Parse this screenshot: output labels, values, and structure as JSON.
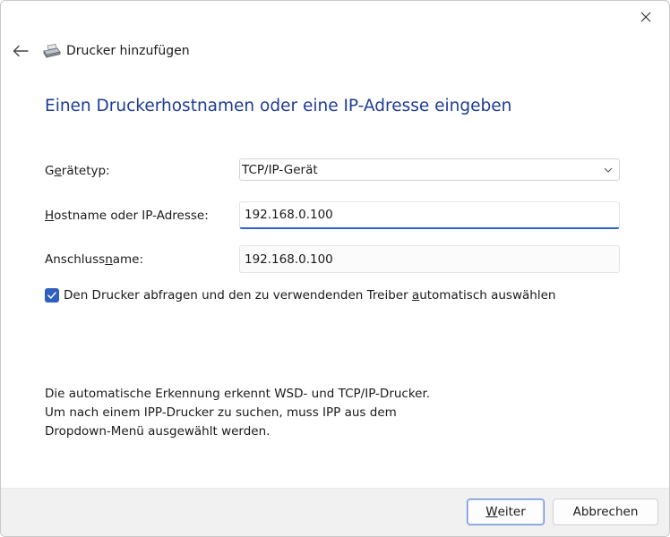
{
  "window": {
    "close_icon": "close-icon",
    "back_icon": "arrow-left-icon",
    "printer_icon": "printer-icon",
    "title": "Drucker hinzufügen"
  },
  "heading": "Einen Druckerhostnamen oder eine IP-Adresse eingeben",
  "form": {
    "device_type": {
      "label_pre": "G",
      "label_accel": "e",
      "label_post": "rätetyp:",
      "value": "TCP/IP-Gerät",
      "arrow_icon": "chevron-down-icon"
    },
    "hostname": {
      "label_pre": "",
      "label_accel": "H",
      "label_post": "ostname oder IP-Adresse:",
      "value": "192.168.0.100"
    },
    "port_name": {
      "label_pre": "Anschluss",
      "label_accel": "n",
      "label_post": "ame:",
      "value": "192.168.0.100"
    },
    "auto_driver": {
      "checked": true,
      "label_pre": "Den Drucker abfragen und den zu verwendenden Treiber ",
      "label_accel": "a",
      "label_post": "utomatisch auswählen"
    }
  },
  "info_lines": [
    "Die automatische Erkennung erkennt WSD- und TCP/IP-Drucker.",
    "Um nach einem IPP-Drucker zu suchen, muss IPP aus dem",
    "Dropdown-Menü ausgewählt werden."
  ],
  "footer": {
    "next_button": {
      "pre": "",
      "accel": "W",
      "post": "eiter"
    },
    "cancel_button": "Abbrechen"
  },
  "colors": {
    "heading": "#1e3c96",
    "accent": "#2f5fbf",
    "footer_bg": "#f1f1f1"
  }
}
